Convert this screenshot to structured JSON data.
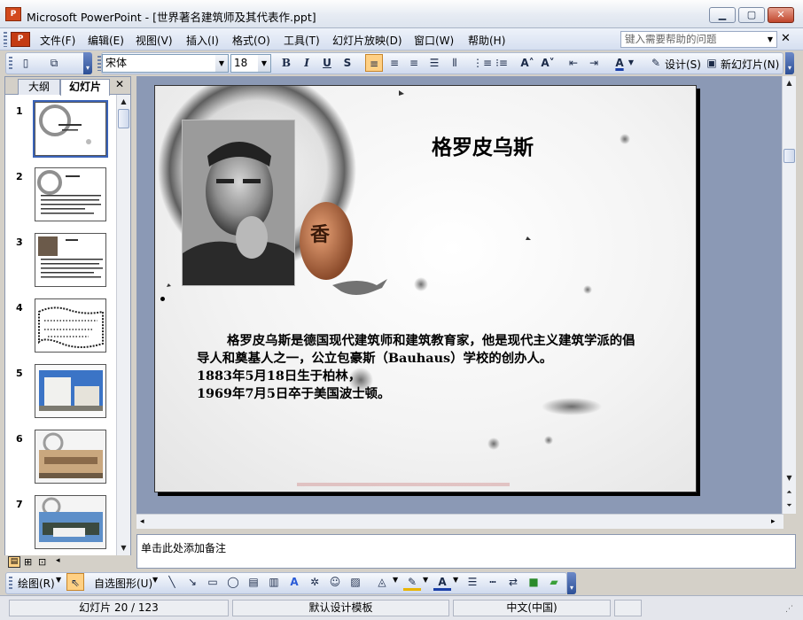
{
  "window": {
    "app_icon": "powerpoint-icon",
    "title": "Microsoft PowerPoint - [世界著名建筑师及其代表作.ppt]",
    "minimize": "▁",
    "maximize": "▢",
    "close": "✕"
  },
  "menu": {
    "items": [
      "文件(F)",
      "编辑(E)",
      "视图(V)",
      "插入(I)",
      "格式(O)",
      "工具(T)",
      "幻灯片放映(D)",
      "窗口(W)",
      "帮助(H)"
    ],
    "help_placeholder": "键入需要帮助的问题",
    "doc_close": "✕"
  },
  "toolbar": {
    "font": "宋体",
    "size": "18",
    "bold": "B",
    "italic": "I",
    "underline": "U",
    "shadow": "S",
    "design_label": "设计(S)",
    "new_slide_label": "新幻灯片(N)"
  },
  "left_pane": {
    "tabs": [
      "大纲",
      "幻灯片"
    ],
    "active_tab": "幻灯片",
    "close": "✕",
    "slide_numbers": [
      "1",
      "2",
      "3",
      "4",
      "5",
      "6",
      "7"
    ],
    "selected_slide": "1"
  },
  "slide": {
    "title": "格罗皮乌斯",
    "body": [
      "格罗皮乌斯是德国现代建筑师和建筑教育家，他是现代主义建筑学派的倡导人和奠基人之一，公立包豪斯（Bauhaus）学校的创办人。",
      "1883年5月18日生于柏林，",
      "1969年7月5日卒于美国波士顿。"
    ],
    "seal_text": "香"
  },
  "notes": {
    "placeholder": "单击此处添加备注"
  },
  "drawbar": {
    "draw_label": "绘图(R)",
    "autoshape_label": "自选图形(U)"
  },
  "status": {
    "slide_indicator": "幻灯片 20 / 123",
    "template": "默认设计模板",
    "language": "中文(中国)"
  },
  "colors": {
    "accent": "#3a63b8",
    "title_bar": "#dde4ee",
    "slide_area": "#8b99b5"
  }
}
